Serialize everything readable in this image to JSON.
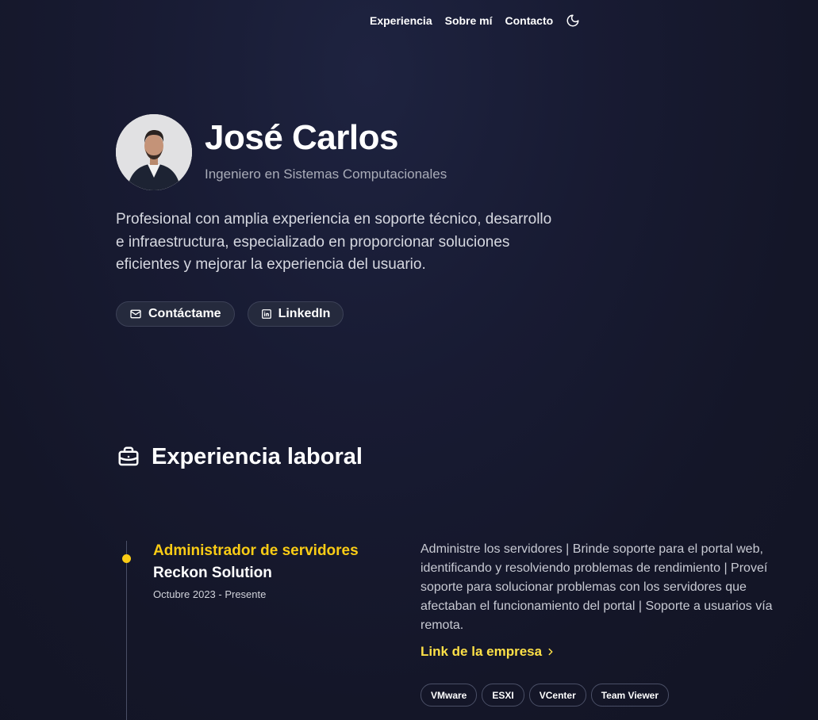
{
  "nav": {
    "items": [
      {
        "label": "Experiencia"
      },
      {
        "label": "Sobre mí"
      },
      {
        "label": "Contacto"
      }
    ],
    "theme_icon": "moon-icon"
  },
  "hero": {
    "name": "José Carlos",
    "title": "Ingeniero en Sistemas Computacionales",
    "bio": "Profesional con amplia experiencia en soporte técnico, desarrollo e infraestructura, especializado en proporcionar soluciones eficientes y mejorar la experiencia del usuario.",
    "buttons": [
      {
        "label": "Contáctame",
        "icon": "mail-icon"
      },
      {
        "label": "LinkedIn",
        "icon": "linkedin-icon"
      }
    ]
  },
  "experience": {
    "section_title": "Experiencia laboral",
    "section_icon": "briefcase-icon",
    "jobs": [
      {
        "role": "Administrador de servidores",
        "company": "Reckon Solution",
        "dates": "Octubre 2023 - Presente",
        "description": "Administre los servidores | Brinde soporte para el portal web, identificando y resolviendo problemas de rendimiento | Proveí soporte para solucionar problemas con los servidores que afectaban el funcionamiento del portal | Soporte a usuarios vía remota.",
        "link_label": "Link de la empresa",
        "tags": [
          "VMware",
          "ESXI",
          "VCenter",
          "Team Viewer"
        ]
      }
    ]
  },
  "colors": {
    "accent": "#facc15",
    "background": "#161929",
    "pill_bg": "#252a3d"
  }
}
